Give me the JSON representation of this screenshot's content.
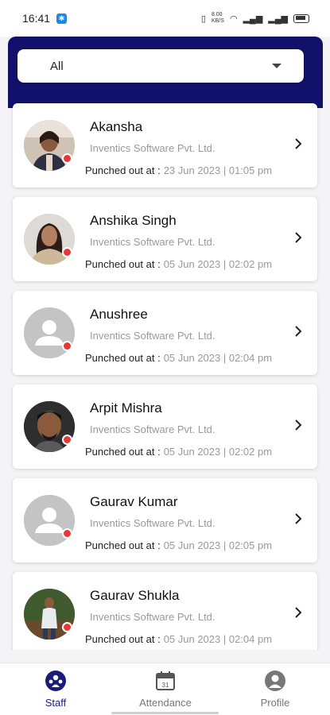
{
  "status_bar": {
    "time": "16:41",
    "right_text": "8.00 KB/S",
    "icons": [
      "notification-app-icon",
      "vibrate-icon",
      "wifi-icon",
      "signal-icon",
      "signal-icon",
      "battery-icon"
    ]
  },
  "filter": {
    "selected": "All"
  },
  "staff": [
    {
      "name": "Akansha",
      "company": "Inventics Software Pvt. Ltd.",
      "punch_label": "Punched out at :",
      "punch_value": "23 Jun 2023 | 01:05 pm",
      "avatar": "photo"
    },
    {
      "name": "Anshika Singh",
      "company": "Inventics Software Pvt. Ltd.",
      "punch_label": "Punched out at :",
      "punch_value": "05 Jun 2023 | 02:02 pm",
      "avatar": "photo"
    },
    {
      "name": "Anushree",
      "company": "Inventics Software Pvt. Ltd.",
      "punch_label": "Punched out at :",
      "punch_value": "05 Jun 2023 | 02:04 pm",
      "avatar": "placeholder"
    },
    {
      "name": "Arpit Mishra",
      "company": "Inventics Software Pvt. Ltd.",
      "punch_label": "Punched out at :",
      "punch_value": "05 Jun 2023 | 02:02 pm",
      "avatar": "photo"
    },
    {
      "name": "Gaurav Kumar",
      "company": "Inventics Software Pvt. Ltd.",
      "punch_label": "Punched out at :",
      "punch_value": "05 Jun 2023 | 02:05 pm",
      "avatar": "placeholder"
    },
    {
      "name": "Gaurav Shukla",
      "company": "Inventics Software Pvt. Ltd.",
      "punch_label": "Punched out at :",
      "punch_value": "05 Jun 2023 | 02:04 pm",
      "avatar": "photo"
    }
  ],
  "bottom_nav": {
    "staff_label": "Staff",
    "attendance_label": "Attendance",
    "profile_label": "Profile"
  },
  "colors": {
    "header": "#11116b",
    "status_dot": "#e53935",
    "active_nav": "#1b1b7a"
  }
}
